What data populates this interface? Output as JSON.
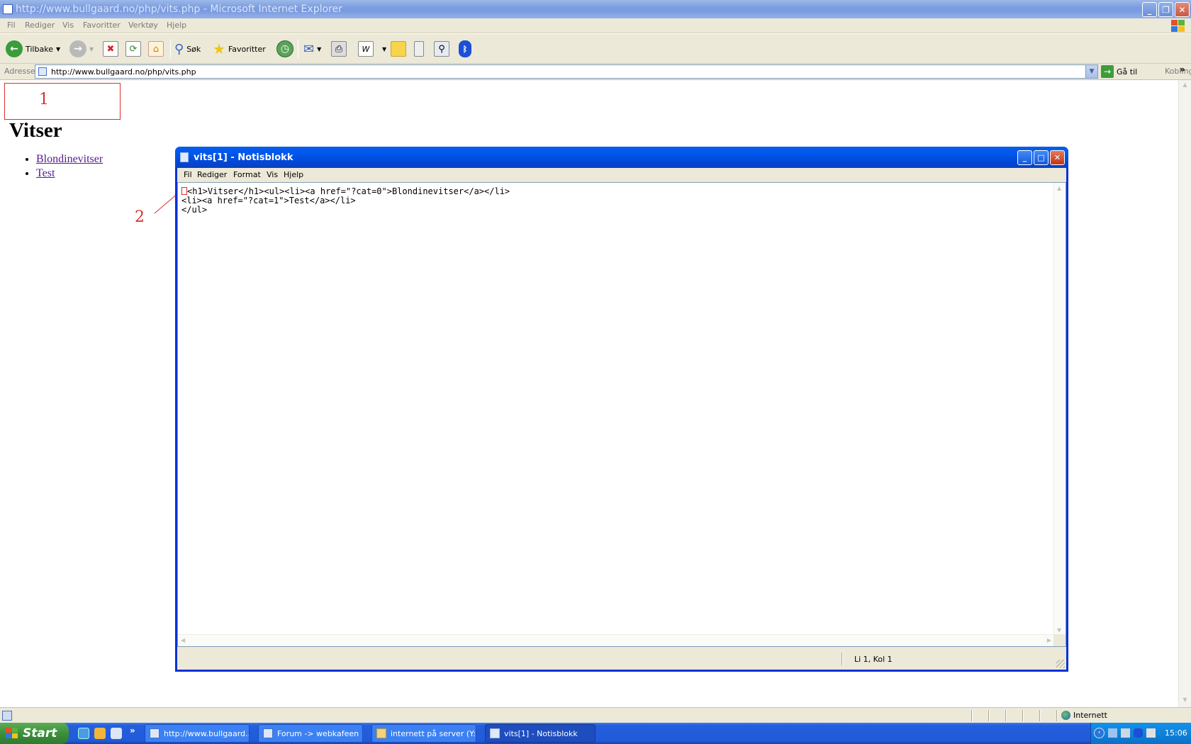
{
  "ie": {
    "title": "http://www.bullgaard.no/php/vits.php - Microsoft Internet Explorer",
    "menu": [
      "Fil",
      "Rediger",
      "Vis",
      "Favoritter",
      "Verktøy",
      "Hjelp"
    ],
    "toolbar": {
      "back": "Tilbake",
      "search": "Søk",
      "favorites": "Favoritter"
    },
    "address_label": "Adresse",
    "address_value": "http://www.bullgaard.no/php/vits.php",
    "go": "Gå til",
    "links": "Koblinger",
    "status_zone": "Internett"
  },
  "page": {
    "heading": "Vitser",
    "links": [
      "Blondinevitser",
      "Test"
    ]
  },
  "annotations": {
    "one": "1",
    "two": "2"
  },
  "notepad": {
    "title": "vits[1] - Notisblokk",
    "menu": [
      "Fil",
      "Rediger",
      "Format",
      "Vis",
      "Hjelp"
    ],
    "line1": "<h1>Vitser</h1><ul><li><a href=\"?cat=0\">Blondinevitser</a></li>",
    "line2": "<li><a href=\"?cat=1\">Test</a></li>",
    "line3": "</ul>",
    "status": "Li 1, Kol 1"
  },
  "taskbar": {
    "start": "Start",
    "tasks": [
      "http://www.bullgaard...",
      "Forum -> webkafeen ...",
      "internett på server (Y:)",
      "vits[1] - Notisblokk"
    ],
    "clock": "15:06"
  },
  "icons": {
    "back": "back-arrow-icon",
    "forward": "forward-arrow-icon",
    "stop": "stop-icon",
    "refresh": "refresh-icon",
    "home": "home-icon",
    "search": "magnifier-icon",
    "favorites": "star-icon",
    "history": "history-icon",
    "mail": "mail-icon",
    "print": "printer-icon",
    "edit": "word-icon",
    "notes": "note-icon",
    "messenger": "mobile-icon",
    "research": "research-icon",
    "bluetooth": "bluetooth-icon"
  },
  "colors": {
    "annotation_red": "#d9302c",
    "xp_blue": "#0831d9",
    "visited_link": "#551a8b"
  }
}
